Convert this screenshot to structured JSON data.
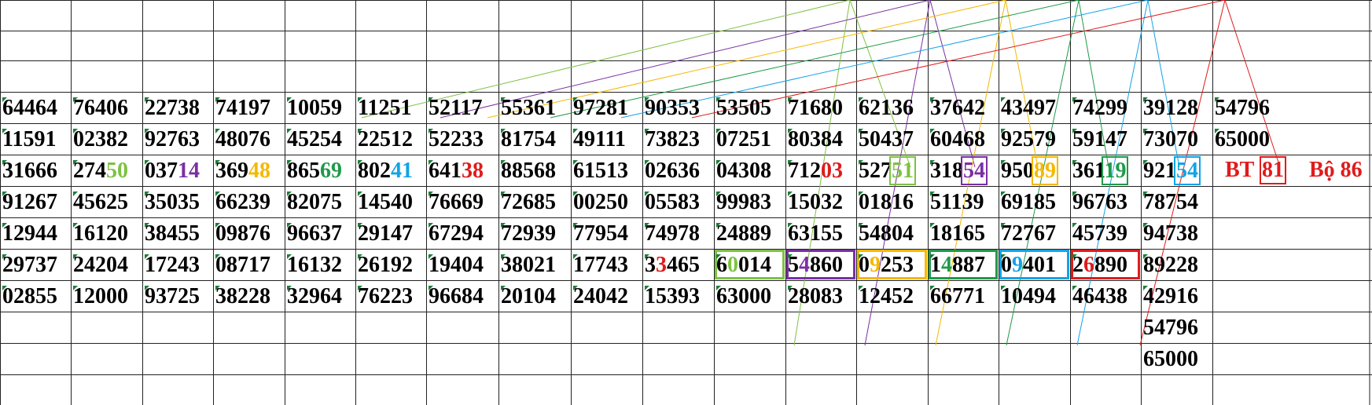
{
  "sheet": {
    "rows": [
      [
        "64464",
        "76406",
        "22738",
        "74197",
        "10059",
        "11251",
        "52117",
        "55361",
        "97281",
        "90353",
        "53505",
        "71680",
        "62136",
        "37642",
        "43497",
        "74299",
        "39128",
        "54796"
      ],
      [
        "11591",
        "02382",
        "92763",
        "48076",
        "45254",
        "22512",
        "52233",
        "81754",
        "49111",
        "73823",
        "07251",
        "80384",
        "50437",
        "60468",
        "92579",
        "59147",
        "73070",
        "65000"
      ],
      [
        "31666",
        "27450",
        "03714",
        "36948",
        "86569",
        "80241",
        "64138",
        "88568",
        "61513",
        "02636",
        "04308",
        "71203",
        "52751",
        "31854",
        "95089",
        "36119",
        "92154"
      ],
      [
        "91267",
        "45625",
        "35035",
        "66239",
        "82075",
        "14540",
        "76669",
        "72685",
        "00250",
        "05583",
        "99983",
        "15032",
        "01816",
        "51139",
        "69185",
        "96763",
        "78754"
      ],
      [
        "12944",
        "16120",
        "38455",
        "09876",
        "96637",
        "29147",
        "67294",
        "72939",
        "77954",
        "74978",
        "24889",
        "63155",
        "54804",
        "18165",
        "72767",
        "45739",
        "94738"
      ],
      [
        "29737",
        "24204",
        "17243",
        "08717",
        "16132",
        "26192",
        "19404",
        "38021",
        "17743",
        "33465",
        "60014",
        "54860",
        "09253",
        "14887",
        "09401",
        "26890",
        "89228"
      ],
      [
        "02855",
        "12000",
        "93725",
        "38228",
        "32964",
        "76223",
        "96684",
        "20104",
        "24042",
        "15393",
        "63000",
        "28083",
        "12452",
        "66771",
        "10494",
        "46438",
        "42916"
      ],
      [
        "",
        "",
        "",
        "",
        "",
        "",
        "",
        "",
        "",
        "",
        "",
        "",
        "",
        "",
        "",
        "",
        "54796"
      ],
      [
        "",
        "",
        "",
        "",
        "",
        "",
        "",
        "",
        "",
        "",
        "",
        "",
        "",
        "",
        "",
        "",
        "65000"
      ]
    ],
    "bt_label": "BT",
    "bt_value": "81",
    "bo_label": "Bộ 86"
  },
  "colors": {
    "green": "#7dc242",
    "purple": "#7b2fa3",
    "orange": "#f5b800",
    "teal": "#1f9a4a",
    "blue": "#12a3e8",
    "red": "#e01b1b"
  }
}
